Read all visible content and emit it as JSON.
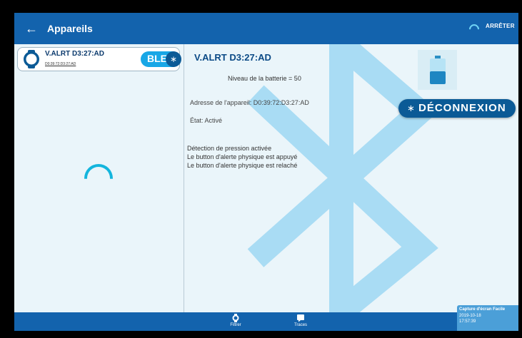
{
  "appbar": {
    "title": "Appareils",
    "back_icon": "arrow-left-icon",
    "stop_label": "ARRÊTER"
  },
  "device_list": [
    {
      "name": "V.ALRT D3:27:AD",
      "mac": "D0:39:72:D3:27:AD",
      "badge": "BLE",
      "icon": "watch-icon",
      "badge_icon": "bluetooth-icon"
    }
  ],
  "detail": {
    "title": "V.ALRT D3:27:AD",
    "battery_text": "Niveau de la batterie = 50",
    "battery_level": 0.5,
    "address": "Adresse de l'appareil: D0:39:72:D3:27:AD",
    "state": "État: Activé",
    "disconnect_label": "DÉCONNEXION",
    "disconnect_icon": "bluetooth-icon",
    "log": [
      "Détection de pression activée",
      "Le button d'alerte physique est appuyé",
      "Le button d'alerte physique est relaché"
    ]
  },
  "bottom_nav": [
    {
      "label": "Filtrer",
      "icon": "watch-icon"
    },
    {
      "label": "Traces",
      "icon": "message-icon"
    }
  ],
  "capture": {
    "title": "Capture d'écran Facile",
    "date": "2019-10-18",
    "time": "17:57:39"
  },
  "colors": {
    "appbar": "#1363ad",
    "accent": "#18a7e6",
    "button": "#0b5a96",
    "background": "#eaf5fa",
    "watermark": "#a9dcf4"
  }
}
